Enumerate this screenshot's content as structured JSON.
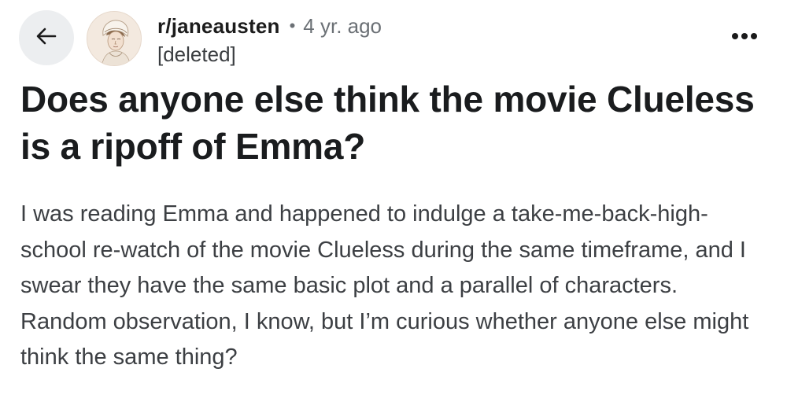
{
  "post": {
    "subreddit": "r/janeausten",
    "separator": "•",
    "age": "4 yr. ago",
    "author": "[deleted]",
    "title": "Does anyone else think the movie Clueless is a ripoff of Emma?",
    "body": "I was reading Emma and happened to indulge a take-me-back-high-school re-watch of the movie Clueless during the same timeframe, and I swear they have the same basic plot and a parallel of characters. Random observation, I know, but I’m curious whether anyone else might think the same thing?"
  },
  "icons": {
    "back": "arrow-left-icon",
    "more": "more-horizontal-icon",
    "avatar": "subreddit-avatar"
  },
  "colors": {
    "back_button_bg": "#eceef0",
    "title": "#1a1c1e",
    "meta_muted": "#6b7075",
    "body": "#3c3f43"
  }
}
